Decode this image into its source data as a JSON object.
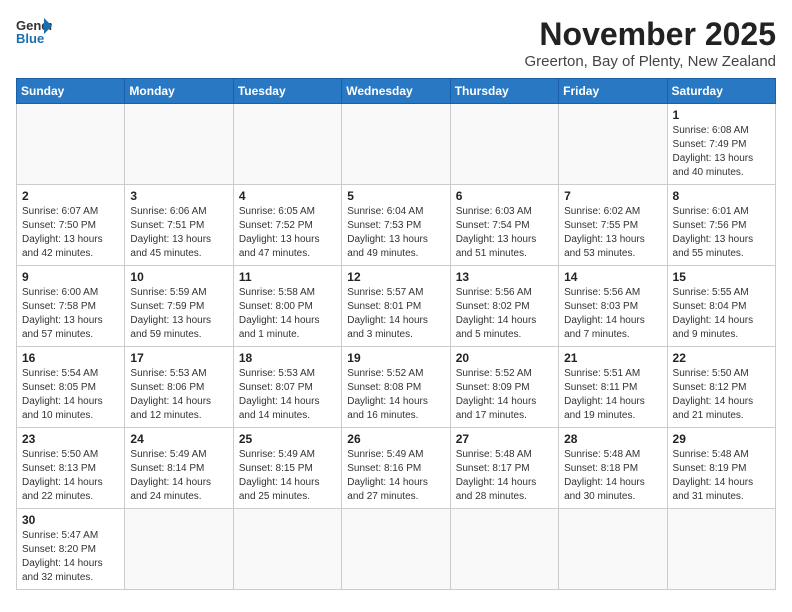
{
  "header": {
    "logo_line1": "General",
    "logo_line2": "Blue",
    "month_title": "November 2025",
    "location": "Greerton, Bay of Plenty, New Zealand"
  },
  "days_of_week": [
    "Sunday",
    "Monday",
    "Tuesday",
    "Wednesday",
    "Thursday",
    "Friday",
    "Saturday"
  ],
  "weeks": [
    [
      {
        "day": "",
        "info": ""
      },
      {
        "day": "",
        "info": ""
      },
      {
        "day": "",
        "info": ""
      },
      {
        "day": "",
        "info": ""
      },
      {
        "day": "",
        "info": ""
      },
      {
        "day": "",
        "info": ""
      },
      {
        "day": "1",
        "info": "Sunrise: 6:08 AM\nSunset: 7:49 PM\nDaylight: 13 hours and 40 minutes."
      }
    ],
    [
      {
        "day": "2",
        "info": "Sunrise: 6:07 AM\nSunset: 7:50 PM\nDaylight: 13 hours and 42 minutes."
      },
      {
        "day": "3",
        "info": "Sunrise: 6:06 AM\nSunset: 7:51 PM\nDaylight: 13 hours and 45 minutes."
      },
      {
        "day": "4",
        "info": "Sunrise: 6:05 AM\nSunset: 7:52 PM\nDaylight: 13 hours and 47 minutes."
      },
      {
        "day": "5",
        "info": "Sunrise: 6:04 AM\nSunset: 7:53 PM\nDaylight: 13 hours and 49 minutes."
      },
      {
        "day": "6",
        "info": "Sunrise: 6:03 AM\nSunset: 7:54 PM\nDaylight: 13 hours and 51 minutes."
      },
      {
        "day": "7",
        "info": "Sunrise: 6:02 AM\nSunset: 7:55 PM\nDaylight: 13 hours and 53 minutes."
      },
      {
        "day": "8",
        "info": "Sunrise: 6:01 AM\nSunset: 7:56 PM\nDaylight: 13 hours and 55 minutes."
      }
    ],
    [
      {
        "day": "9",
        "info": "Sunrise: 6:00 AM\nSunset: 7:58 PM\nDaylight: 13 hours and 57 minutes."
      },
      {
        "day": "10",
        "info": "Sunrise: 5:59 AM\nSunset: 7:59 PM\nDaylight: 13 hours and 59 minutes."
      },
      {
        "day": "11",
        "info": "Sunrise: 5:58 AM\nSunset: 8:00 PM\nDaylight: 14 hours and 1 minute."
      },
      {
        "day": "12",
        "info": "Sunrise: 5:57 AM\nSunset: 8:01 PM\nDaylight: 14 hours and 3 minutes."
      },
      {
        "day": "13",
        "info": "Sunrise: 5:56 AM\nSunset: 8:02 PM\nDaylight: 14 hours and 5 minutes."
      },
      {
        "day": "14",
        "info": "Sunrise: 5:56 AM\nSunset: 8:03 PM\nDaylight: 14 hours and 7 minutes."
      },
      {
        "day": "15",
        "info": "Sunrise: 5:55 AM\nSunset: 8:04 PM\nDaylight: 14 hours and 9 minutes."
      }
    ],
    [
      {
        "day": "16",
        "info": "Sunrise: 5:54 AM\nSunset: 8:05 PM\nDaylight: 14 hours and 10 minutes."
      },
      {
        "day": "17",
        "info": "Sunrise: 5:53 AM\nSunset: 8:06 PM\nDaylight: 14 hours and 12 minutes."
      },
      {
        "day": "18",
        "info": "Sunrise: 5:53 AM\nSunset: 8:07 PM\nDaylight: 14 hours and 14 minutes."
      },
      {
        "day": "19",
        "info": "Sunrise: 5:52 AM\nSunset: 8:08 PM\nDaylight: 14 hours and 16 minutes."
      },
      {
        "day": "20",
        "info": "Sunrise: 5:52 AM\nSunset: 8:09 PM\nDaylight: 14 hours and 17 minutes."
      },
      {
        "day": "21",
        "info": "Sunrise: 5:51 AM\nSunset: 8:11 PM\nDaylight: 14 hours and 19 minutes."
      },
      {
        "day": "22",
        "info": "Sunrise: 5:50 AM\nSunset: 8:12 PM\nDaylight: 14 hours and 21 minutes."
      }
    ],
    [
      {
        "day": "23",
        "info": "Sunrise: 5:50 AM\nSunset: 8:13 PM\nDaylight: 14 hours and 22 minutes."
      },
      {
        "day": "24",
        "info": "Sunrise: 5:49 AM\nSunset: 8:14 PM\nDaylight: 14 hours and 24 minutes."
      },
      {
        "day": "25",
        "info": "Sunrise: 5:49 AM\nSunset: 8:15 PM\nDaylight: 14 hours and 25 minutes."
      },
      {
        "day": "26",
        "info": "Sunrise: 5:49 AM\nSunset: 8:16 PM\nDaylight: 14 hours and 27 minutes."
      },
      {
        "day": "27",
        "info": "Sunrise: 5:48 AM\nSunset: 8:17 PM\nDaylight: 14 hours and 28 minutes."
      },
      {
        "day": "28",
        "info": "Sunrise: 5:48 AM\nSunset: 8:18 PM\nDaylight: 14 hours and 30 minutes."
      },
      {
        "day": "29",
        "info": "Sunrise: 5:48 AM\nSunset: 8:19 PM\nDaylight: 14 hours and 31 minutes."
      }
    ],
    [
      {
        "day": "30",
        "info": "Sunrise: 5:47 AM\nSunset: 8:20 PM\nDaylight: 14 hours and 32 minutes."
      },
      {
        "day": "",
        "info": ""
      },
      {
        "day": "",
        "info": ""
      },
      {
        "day": "",
        "info": ""
      },
      {
        "day": "",
        "info": ""
      },
      {
        "day": "",
        "info": ""
      },
      {
        "day": "",
        "info": ""
      }
    ]
  ]
}
